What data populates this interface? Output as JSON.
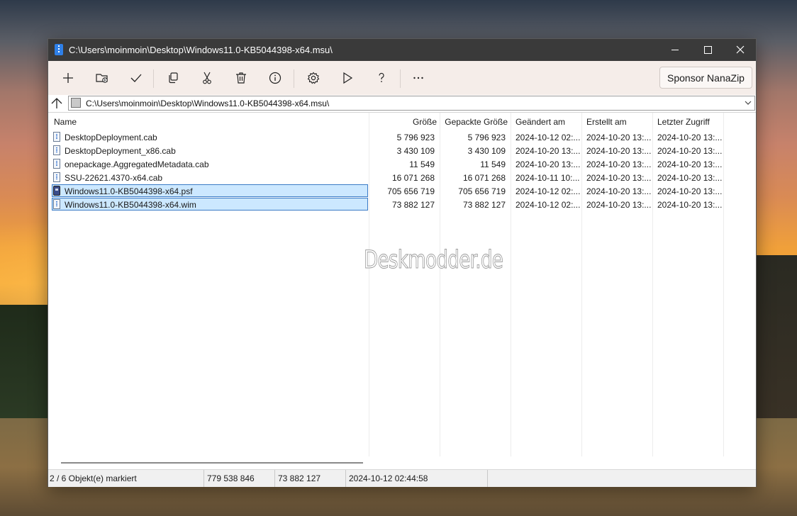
{
  "window": {
    "title": "C:\\Users\\moinmoin\\Desktop\\Windows11.0-KB5044398-x64.msu\\"
  },
  "toolbar": {
    "buttons": [
      {
        "name": "add",
        "icon": "plus-icon"
      },
      {
        "name": "extract",
        "icon": "folder-extract-icon"
      },
      {
        "name": "test",
        "icon": "checkmark-icon"
      },
      {
        "name": "copy",
        "icon": "copy-icon"
      },
      {
        "name": "move",
        "icon": "scissors-icon"
      },
      {
        "name": "delete",
        "icon": "trash-icon"
      },
      {
        "name": "info",
        "icon": "info-icon"
      },
      {
        "name": "settings",
        "icon": "gear-icon"
      },
      {
        "name": "run",
        "icon": "play-icon"
      },
      {
        "name": "help",
        "icon": "question-icon"
      },
      {
        "name": "more",
        "icon": "ellipsis-icon"
      }
    ],
    "sponsor_label": "Sponsor NanaZip"
  },
  "address": {
    "path": "C:\\Users\\moinmoin\\Desktop\\Windows11.0-KB5044398-x64.msu\\"
  },
  "columns": {
    "name": "Name",
    "size": "Größe",
    "packed": "Gepackte Größe",
    "modified": "Geändert am",
    "created": "Erstellt am",
    "accessed": "Letzter Zugriff"
  },
  "files": [
    {
      "name": "DesktopDeployment.cab",
      "size": "5 796 923",
      "packed": "5 796 923",
      "modified": "2024-10-12 02:...",
      "created": "2024-10-20 13:...",
      "accessed": "2024-10-20 13:..."
    },
    {
      "name": "DesktopDeployment_x86.cab",
      "size": "3 430 109",
      "packed": "3 430 109",
      "modified": "2024-10-20 13:...",
      "created": "2024-10-20 13:...",
      "accessed": "2024-10-20 13:..."
    },
    {
      "name": "onepackage.AggregatedMetadata.cab",
      "size": "11 549",
      "packed": "11 549",
      "modified": "2024-10-20 13:...",
      "created": "2024-10-20 13:...",
      "accessed": "2024-10-20 13:..."
    },
    {
      "name": "SSU-22621.4370-x64.cab",
      "size": "16 071 268",
      "packed": "16 071 268",
      "modified": "2024-10-11 10:...",
      "created": "2024-10-20 13:...",
      "accessed": "2024-10-20 13:..."
    },
    {
      "name": "Windows11.0-KB5044398-x64.psf",
      "size": "705 656 719",
      "packed": "705 656 719",
      "modified": "2024-10-12 02:...",
      "created": "2024-10-20 13:...",
      "accessed": "2024-10-20 13:..."
    },
    {
      "name": "Windows11.0-KB5044398-x64.wim",
      "size": "73 882 127",
      "packed": "73 882 127",
      "modified": "2024-10-12 02:...",
      "created": "2024-10-20 13:...",
      "accessed": "2024-10-20 13:..."
    }
  ],
  "watermark": "Deskmodder.de",
  "status": {
    "selection": "2 / 6 Objekt(e) markiert",
    "total_size": "779 538 846",
    "packed_size": "73 882 127",
    "date": "2024-10-12 02:44:58"
  }
}
